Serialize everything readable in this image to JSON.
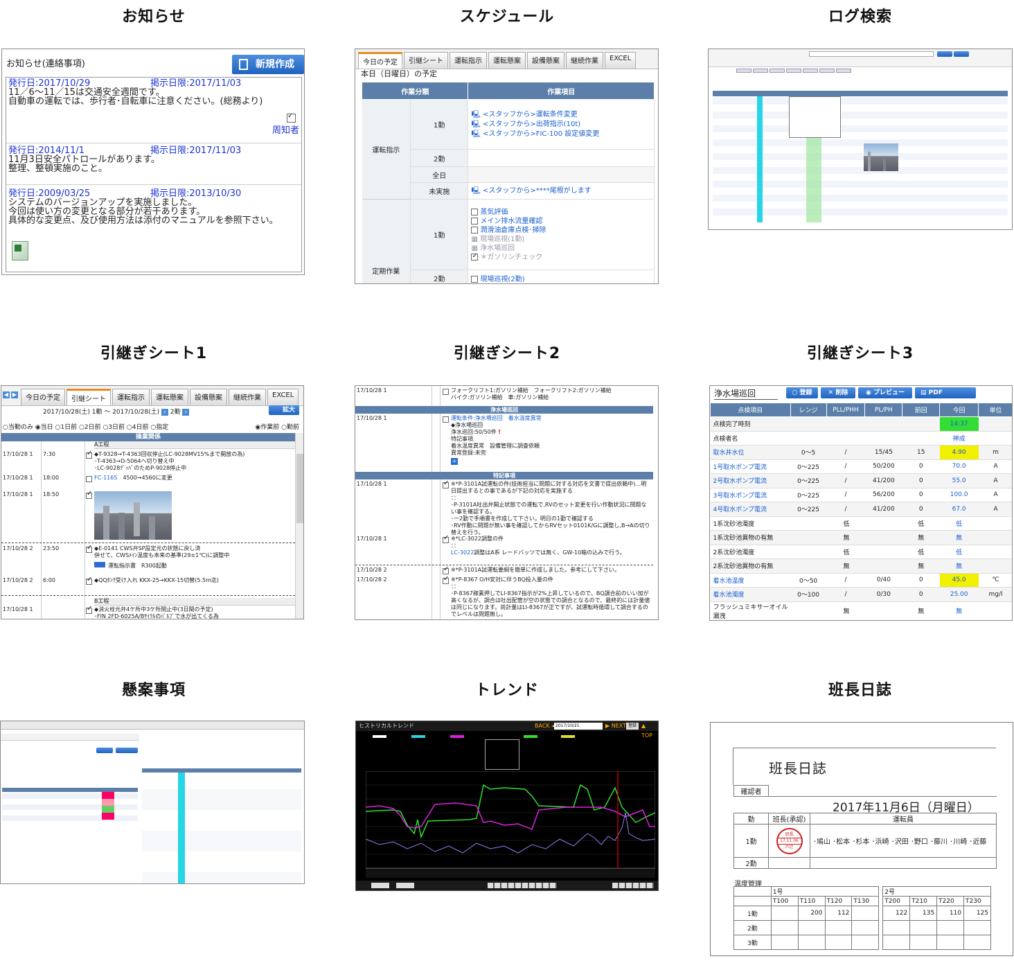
{
  "titles": {
    "t1": "お知らせ",
    "t2": "スケジュール",
    "t3": "ログ検索",
    "t4": "引継ぎシート1",
    "t5": "引継ぎシート2",
    "t6": "引継ぎシート3",
    "t7": "懸案事項",
    "t8": "トレンド",
    "t9": "班長日誌"
  },
  "notice": {
    "header": "お知らせ(連絡事項)",
    "new_btn": "新規作成",
    "items": [
      {
        "date": "発行日:2017/10/29",
        "limit": "掲示日限:2017/11/03",
        "l1": "11／6～11／15は交通安全週間です。",
        "l2": "自動車の運転では、歩行者･自転車に注意ください。(総務より)"
      },
      {
        "date": "発行日:2014/11/1",
        "limit": "掲示日限:2017/11/03",
        "l1": "11月3日安全パトロールがあります。",
        "l2": "整理、整頓実施のこと。"
      },
      {
        "date": "発行日:2009/03/25",
        "limit": "掲示日限:2013/10/30",
        "l1": "システムのバージョンアップを実施しました。",
        "l2": "今回は使い方の変更となる部分が若干あります。",
        "l3": "具体的な変更点、及び使用方法は添付のマニュアルを参照下さい。"
      }
    ],
    "ack": "周知者"
  },
  "schedule": {
    "tabs": [
      "今日の予定",
      "引継シート",
      "運転指示",
      "運転懸案",
      "設備懸案",
      "継続作業",
      "EXCEL"
    ],
    "sub": "本日（日曜日）の予定",
    "col1": "作業分類",
    "col2": "作業項目",
    "g1": "運転指示",
    "g2": "定期作業",
    "s1": "1勤",
    "s2": "2勤",
    "s3": "全日",
    "s4": "未実施",
    "a1": "<スタッフから>運転条件変更",
    "a2": "<スタッフから>出荷指示(10t)",
    "a3": "<スタッフから>FIC-100 設定値変更",
    "a4": "<スタッフから>****尾根がします",
    "p1": "蒸気評価",
    "p2": "メイン排水流量確認",
    "p3": "潤滑油倉庫点検･掃除",
    "p4": "現場巡視(1勤)",
    "p5": "浄水場巡回",
    "p6": "＊ガソリンチェック",
    "p7": "現場巡視(2勤)"
  },
  "ho1": {
    "tabs": [
      "今日の予定",
      "引継シート",
      "運転指示",
      "運転懸案",
      "設備懸案",
      "継続作業",
      "EXCEL"
    ],
    "expand": "拡大",
    "range": "2017/10/28(土) 1勤 ～ 2017/10/28(土)",
    "shift": "2勤",
    "radios": [
      "当勤のみ",
      "当日",
      "1日前",
      "2日前",
      "3日前",
      "4日前",
      "指定"
    ],
    "r2": [
      "作業前",
      "勤前"
    ],
    "section": "操業関係",
    "area1": "A工程",
    "area2": "B工程",
    "rows": [
      {
        "d": "17/10/28 1",
        "t": "7:30",
        "l1": "◆T-9328→T-4363回収停止(LC-9028MV15%まで開放の為)",
        "l2": "･T-4363→D-5064へ切り替え中",
        "l3": "･LC-9028ｸﾞｯﾊﾞのためP-9028停止中"
      },
      {
        "d": "17/10/28 1",
        "t": "18:00",
        "l1": "FC-1165",
        "l1b": "4500→4560に変更"
      },
      {
        "d": "17/10/28 1",
        "t": "18:50"
      },
      {
        "d": "17/10/28 2",
        "t": "23:50",
        "l1": "◆E-0141 CWS弁SP設定元の状態に戻し済",
        "l2": "併せて、CWSﾒｲﾝ温度も本来の基準(29±1℃)に調整中",
        "l3": "運転指示書　R300起動"
      },
      {
        "d": "17/10/28 2",
        "t": "6:00",
        "l1": "◆QQﾀﾝｸ受け入れ KKX-25→KKX-15切替(5.5m迄)"
      },
      {
        "d": "17/10/28 1",
        "t": "",
        "l1": "◆消火栓元弁4ケ所中3ケ所閉止中(3日間の予定)",
        "l2": "･FIN 2FD-6025A/Bｻｲｸﾙのﾊﾞﾙﾌﾞで水が出てくる為"
      }
    ]
  },
  "ho2": {
    "sec1": "浄水場巡回",
    "sec2": "特記事項",
    "r0d": "17/10/28 1",
    "r0a": "フォークリフト1:ガソリン補給　フォークリフト2:ガソリン補給",
    "r0b": "バイク:ガソリン補給　車:ガソリン補給",
    "r1d": "17/10/28 1",
    "r1a": "運転条件:浄水場巡回　着水温度異常",
    "r1b": "◆浄水場巡回",
    "r1c": "浄水巡回:50/50件",
    "r1d2": "特記事項",
    "r1e": "着水温度異常　設備管理に調査依頼",
    "r1f": "異常登録:未完",
    "r2d": "17/10/28 1",
    "r2a": "※*P-3101A試運転の件(技術担当に問題に対する対応を文書で提出依頼中)…明日提出するとの事であるが下記の対応を実施する",
    "r2b": "･P-3101A吐出弁開止状態での運転で,RVのセット変更を行い作動状況に問題ない事を確認する。",
    "r2c": "･一2勤で手順書を作成して下さい。明日の1勤で確認する",
    "r2e": "･RV作動に問題が無い事を確認してからRVセット0101K/Gに調整し,B→Aの切り替えを行う。",
    "r3d": "17/10/28 1",
    "r3a": "※*LC-3022調整の件",
    "r3b": "LC-3022",
    "r3c": "調整はA系 レードバッツでは無く、GW-10箱の込みで行う。",
    "r4d": "17/10/28 2",
    "r4a": "※*P-3101A試運転要綱を簡単に作成しました。参考にして下さい。",
    "r5d": "17/10/28 2",
    "r5a": "※*P-8367 O/H安対に伴うBQ投入量の件",
    "r5b": "･P-8367稼素押しでLI-8367指示が2%上昇しているので、BQ調合前のいい加が高くなるが、調合は吐出配管が空の状態での調合となるので、最終的には計量値は同じになります。尚計量はLI-8367が正ですが、試運転時循環して調合するのでレベルは問題無し。"
  },
  "ho3": {
    "title": "浄水場巡回",
    "b1": "登録",
    "b2": "削除",
    "b3": "プレビュー",
    "b4": "PDF",
    "cols": [
      "点検項目",
      "レンジ",
      "PLL/PHH",
      "PL/PH",
      "前回",
      "今回",
      "単位"
    ],
    "rows": [
      {
        "n": "点検完了時刻",
        "r": "",
        "p1": "",
        "p2": "",
        "pr": "",
        "c": "14:37",
        "u": "",
        "hl": "g",
        "lk": false
      },
      {
        "n": "点検者名",
        "r": "",
        "p1": "",
        "p2": "",
        "pr": "",
        "c": "神成",
        "u": "",
        "hl": "",
        "lk": false
      },
      {
        "n": "取水井水位",
        "r": "0～5",
        "p1": "/",
        "p2": "15/45",
        "pr": "15",
        "c": "4.90",
        "u": "m",
        "hl": "y",
        "lk": true
      },
      {
        "n": "1号取水ポンプ電流",
        "r": "0～225",
        "p1": "/",
        "p2": "50/200",
        "pr": "0",
        "c": "70.0",
        "u": "A",
        "hl": "",
        "lk": true
      },
      {
        "n": "2号取水ポンプ電流",
        "r": "0～225",
        "p1": "/",
        "p2": "41/200",
        "pr": "0",
        "c": "55.0",
        "u": "A",
        "hl": "",
        "lk": true
      },
      {
        "n": "3号取水ポンプ電流",
        "r": "0～225",
        "p1": "/",
        "p2": "56/200",
        "pr": "0",
        "c": "100.0",
        "u": "A",
        "hl": "",
        "lk": true
      },
      {
        "n": "4号取水ポンプ電流",
        "r": "0～225",
        "p1": "/",
        "p2": "41/200",
        "pr": "0",
        "c": "67.0",
        "u": "A",
        "hl": "",
        "lk": true
      },
      {
        "n": "1系沈砂池濁度",
        "r": "",
        "p1": "低",
        "p2": "",
        "pr": "低",
        "c": "低",
        "u": "",
        "hl": "",
        "lk": false,
        "m": true
      },
      {
        "n": "1系沈砂池異物の有無",
        "r": "",
        "p1": "無",
        "p2": "",
        "pr": "無",
        "c": "無",
        "u": "",
        "hl": "",
        "lk": false,
        "m": true
      },
      {
        "n": "2系沈砂池濁度",
        "r": "",
        "p1": "低",
        "p2": "",
        "pr": "低",
        "c": "低",
        "u": "",
        "hl": "",
        "lk": false,
        "m": true
      },
      {
        "n": "2系沈砂池異物の有無",
        "r": "",
        "p1": "無",
        "p2": "",
        "pr": "無",
        "c": "無",
        "u": "",
        "hl": "",
        "lk": false,
        "m": true
      },
      {
        "n": "着水池温度",
        "r": "0～50",
        "p1": "/",
        "p2": "0/40",
        "pr": "0",
        "c": "45.0",
        "u": "℃",
        "hl": "y",
        "lk": true
      },
      {
        "n": "着水池濁度",
        "r": "0～100",
        "p1": "/",
        "p2": "0/30",
        "pr": "0",
        "c": "25.00",
        "u": "mg/l",
        "hl": "",
        "lk": true
      },
      {
        "n": "フラッシュミキサーオイル漏洩",
        "r": "",
        "p1": "無",
        "p2": "",
        "pr": "無",
        "c": "無",
        "u": "",
        "hl": "",
        "lk": false,
        "m": true
      }
    ]
  },
  "trend": {
    "title": "ヒストリカルトレンド",
    "back": "BACK",
    "next": "NEXT",
    "date": "2017/10/21",
    "btn": "登録",
    "top": "TOP"
  },
  "diary": {
    "title": "班長日誌",
    "confirm": "確認者",
    "date": "2017年11月6日（月曜日）",
    "c_shift": "勤",
    "c_leader": "班長(承認)",
    "c_ops": "運転員",
    "s1": "1勤",
    "s2": "2勤",
    "stamp_top": "班長",
    "stamp_mid": "17.11.06",
    "stamp_bot": "六辻",
    "ops": "･鳩山 ･松本 ･杉本 ･浜崎 ･沢田 ･野口 ･藤川 ･川崎 ･近藤",
    "temp": "温度管理",
    "g1": "1号",
    "g2": "2号",
    "heads": [
      "T100",
      "T110",
      "T120",
      "T130",
      "T200",
      "T210",
      "T220",
      "T230"
    ],
    "rows": [
      {
        "s": "1勤",
        "v": [
          "",
          "200",
          "112",
          "",
          "122",
          "135",
          "110",
          "125"
        ]
      },
      {
        "s": "2勤",
        "v": [
          "",
          "",
          "",
          "",
          "",
          "",
          "",
          ""
        ]
      },
      {
        "s": "3勤",
        "v": [
          "",
          "",
          "",
          "",
          "",
          "",
          "",
          ""
        ]
      }
    ]
  }
}
